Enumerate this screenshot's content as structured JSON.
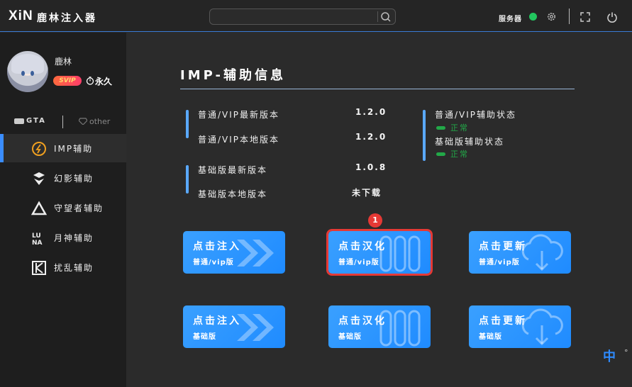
{
  "app": {
    "logo": "XiN",
    "title": "鹿林注入器"
  },
  "search": {
    "value": "",
    "placeholder": ""
  },
  "header": {
    "server_label": "服务器",
    "server_status_color": "#22c55e"
  },
  "user": {
    "name": "鹿林",
    "badge": "SVIP",
    "duration": "永久"
  },
  "game_tabs": [
    {
      "label": "GTA"
    },
    {
      "label": "other"
    }
  ],
  "nav": [
    {
      "label": "IMP辅助",
      "icon": "imp-logo-icon",
      "active": true
    },
    {
      "label": "幻影辅助",
      "icon": "phantom-logo-icon"
    },
    {
      "label": "守望者辅助",
      "icon": "watcher-logo-icon"
    },
    {
      "label": "月神辅助",
      "icon": "luna-logo-icon"
    },
    {
      "label": "扰乱辅助",
      "icon": "disrupt-logo-icon"
    }
  ],
  "main": {
    "title": "IMP-辅助信息",
    "versions": [
      {
        "label": "普通/VIP最新版本",
        "value": "1.2.0"
      },
      {
        "label": "普通/VIP本地版本",
        "value": "1.2.0"
      },
      {
        "label": "基础版最新版本",
        "value": "1.0.8"
      },
      {
        "label": "基础版本地版本",
        "value": "未下载"
      }
    ],
    "status": [
      {
        "label": "普通/VIP辅助状态",
        "value": "正常"
      },
      {
        "label": "基础版辅助状态",
        "value": "正常"
      }
    ],
    "cards": [
      {
        "title": "点击注入",
        "sub": "普通/vip版",
        "icon": "chevrons-right-icon"
      },
      {
        "title": "点击汉化",
        "sub": "普通/vip版",
        "icon": "books-icon"
      },
      {
        "title": "点击更新",
        "sub": "普通/vip版",
        "icon": "cloud-download-icon"
      },
      {
        "title": "点击注入",
        "sub": "基础版",
        "icon": "chevrons-right-icon"
      },
      {
        "title": "点击汉化",
        "sub": "基础版",
        "icon": "books-icon"
      },
      {
        "title": "点击更新",
        "sub": "基础版",
        "icon": "cloud-download-icon"
      }
    ],
    "step_badge": "1"
  },
  "ime": {
    "mode": "中",
    "punct": "°"
  }
}
